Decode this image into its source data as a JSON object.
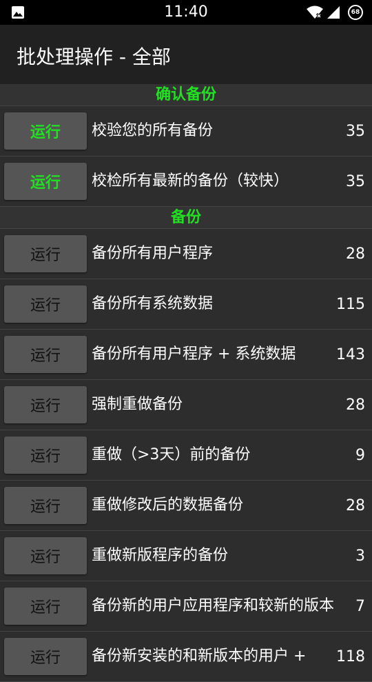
{
  "status_bar": {
    "time": "11:40",
    "battery": "68",
    "icons": [
      "image-icon",
      "wifi-off-icon",
      "signal-icon",
      "battery-icon"
    ]
  },
  "app_bar": {
    "title": "批处理操作 - 全部"
  },
  "colors": {
    "section_header": "#22e022",
    "background": "#2d2d2d",
    "button": "#555555"
  },
  "sections": [
    {
      "header": "确认备份",
      "items": [
        {
          "button": "运行",
          "label": "校验您的所有备份",
          "count": "35"
        },
        {
          "button": "运行",
          "label": "校检所有最新的备份（较快）",
          "count": "35"
        }
      ]
    },
    {
      "header": "备份",
      "items": [
        {
          "button": "运行",
          "label": "备份所有用户程序",
          "count": "28"
        },
        {
          "button": "运行",
          "label": "备份所有系统数据",
          "count": "115"
        },
        {
          "button": "运行",
          "label": "备份所有用户程序 + 系统数据",
          "count": "143"
        },
        {
          "button": "运行",
          "label": "强制重做备份",
          "count": "28"
        },
        {
          "button": "运行",
          "label": "重做（>3天）前的备份",
          "count": "9"
        },
        {
          "button": "运行",
          "label": "重做修改后的数据备份",
          "count": "28"
        },
        {
          "button": "运行",
          "label": "重做新版程序的备份",
          "count": "3"
        },
        {
          "button": "运行",
          "label": "备份新的用户应用程序和较新的版本",
          "count": "7"
        },
        {
          "button": "运行",
          "label": "备份新安装的和新版本的用户 +",
          "count": "118"
        }
      ]
    }
  ]
}
